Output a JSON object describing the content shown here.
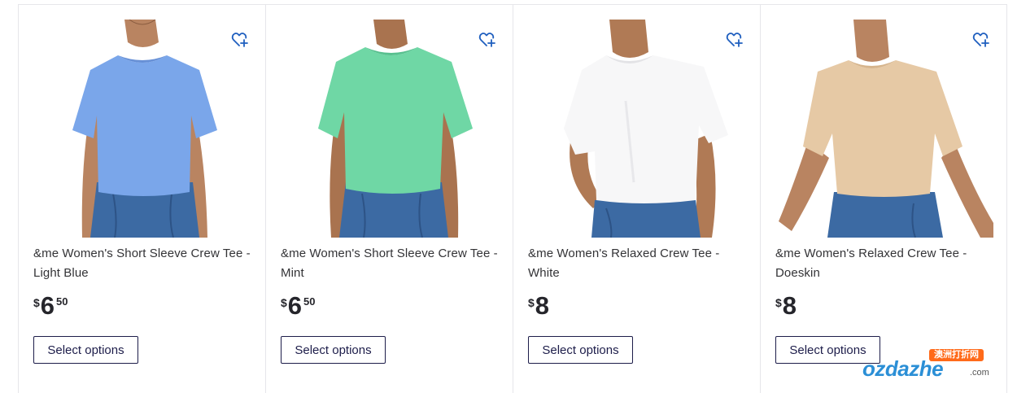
{
  "products": [
    {
      "title": "&me Women's Short Sleeve Crew Tee - Light Blue",
      "currency": "$",
      "dollars": "6",
      "cents": "50",
      "button_label": "Select options",
      "shirt_color": "#7aa6ea",
      "shirt_shade": "#6790d6",
      "icon": "heart-plus-icon"
    },
    {
      "title": "&me Women's Short Sleeve Crew Tee - Mint",
      "currency": "$",
      "dollars": "6",
      "cents": "50",
      "button_label": "Select options",
      "shirt_color": "#6fd7a5",
      "shirt_shade": "#58c08f",
      "icon": "heart-plus-icon"
    },
    {
      "title": "&me Women's Relaxed Crew Tee - White",
      "currency": "$",
      "dollars": "8",
      "cents": "",
      "button_label": "Select options",
      "shirt_color": "#f7f7f8",
      "shirt_shade": "#e3e3e6",
      "icon": "heart-plus-icon"
    },
    {
      "title": "&me Women's Relaxed Crew Tee - Doeskin",
      "currency": "$",
      "dollars": "8",
      "cents": "",
      "button_label": "Select options",
      "shirt_color": "#e6c9a5",
      "shirt_shade": "#d6b48c",
      "icon": "heart-plus-icon"
    }
  ],
  "watermark": {
    "badge": "澳洲打折网",
    "text": "ozdazhe",
    "suffix": ".com"
  },
  "colors": {
    "accent": "#1d1d4a",
    "icon_blue": "#1f5fbf",
    "skin": "#b98461",
    "denim": "#3c6aa3"
  }
}
